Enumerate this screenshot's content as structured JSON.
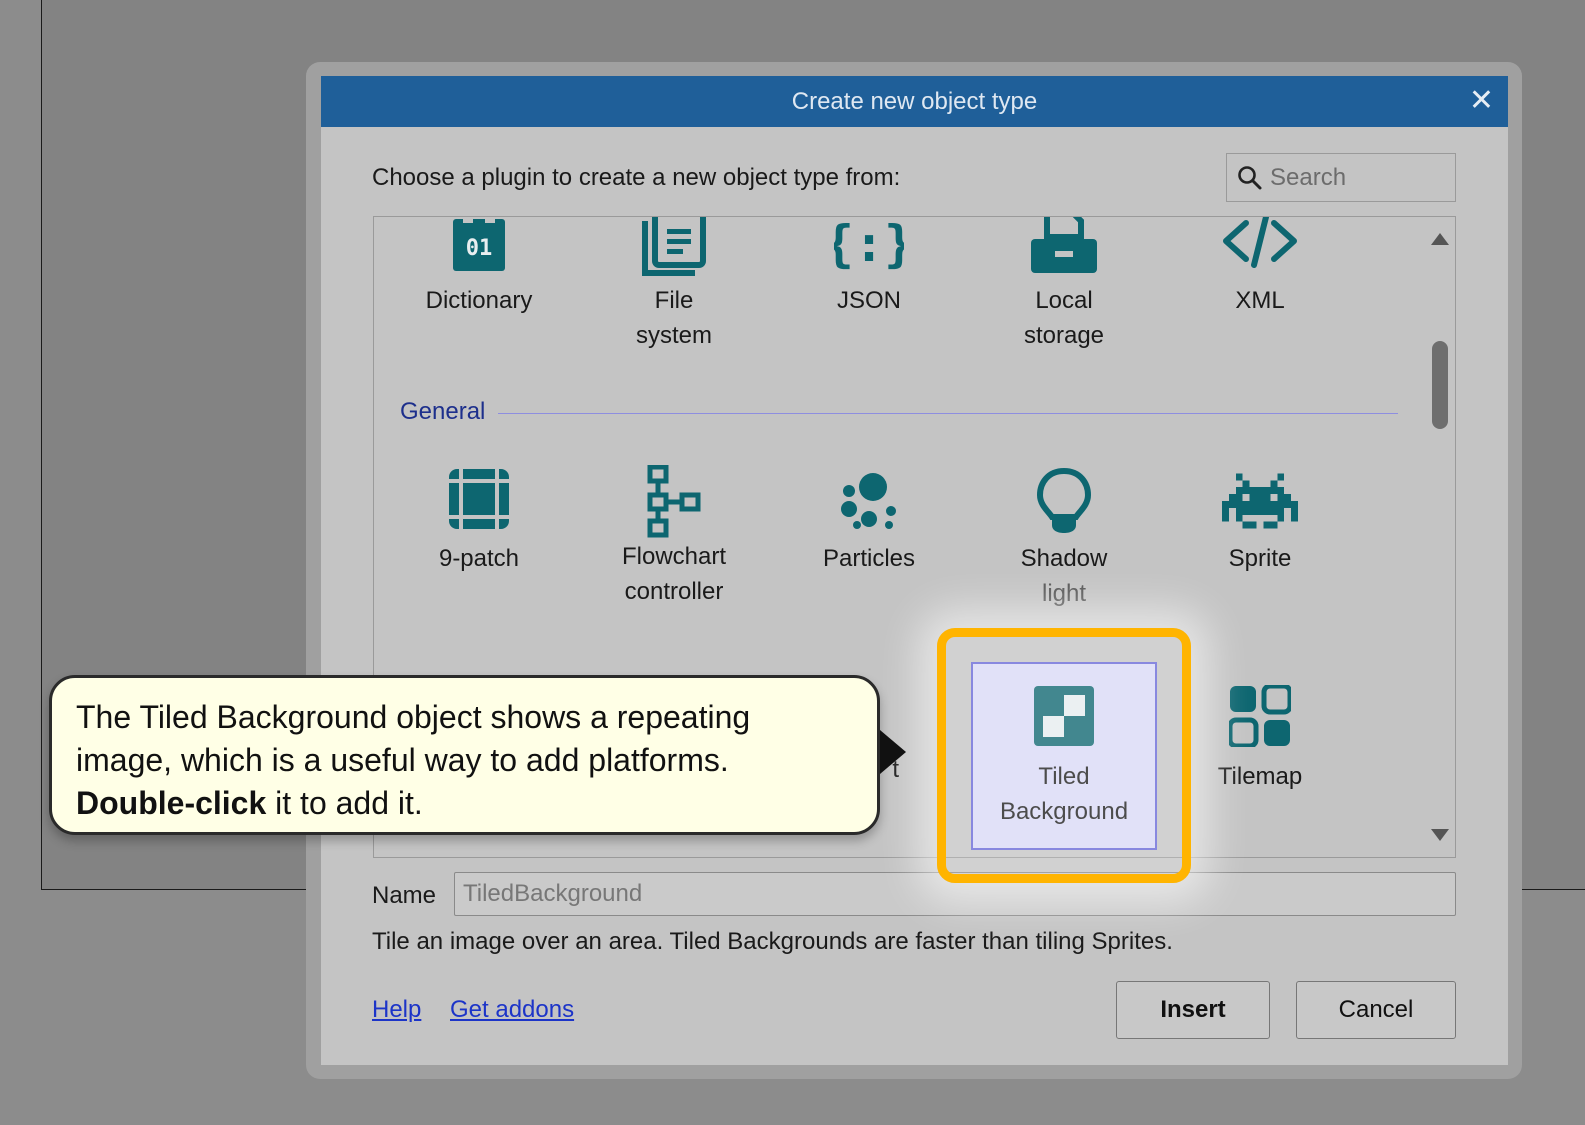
{
  "dialog": {
    "title": "Create new object type",
    "prompt": "Choose a plugin to create a new object type from:",
    "search_placeholder": "Search",
    "close_glyph": "✕"
  },
  "plugins_top": [
    {
      "line1": "Dictionary",
      "line2": "",
      "icon": "dictionary-icon"
    },
    {
      "line1": "File",
      "line2": "system",
      "icon": "file-system-icon"
    },
    {
      "line1": "JSON",
      "line2": "",
      "icon": "json-icon"
    },
    {
      "line1": "Local",
      "line2": "storage",
      "icon": "local-storage-icon"
    },
    {
      "line1": "XML",
      "line2": "",
      "icon": "xml-icon"
    }
  ],
  "section_general": "General",
  "plugins_general": [
    {
      "line1": "9-patch",
      "line2": "",
      "icon": "nine-patch-icon"
    },
    {
      "line1": "Flowchart",
      "line2": "controller",
      "icon": "flowchart-icon"
    },
    {
      "line1": "Particles",
      "line2": "",
      "icon": "particles-icon"
    },
    {
      "line1": "Shadow",
      "line2": "light",
      "icon": "shadow-light-icon"
    },
    {
      "line1": "Sprite",
      "line2": "",
      "icon": "sprite-icon"
    }
  ],
  "plugins_row3": [
    {
      "line1": "t",
      "line2": "",
      "icon": "partial-icon"
    },
    {
      "line1": "Tiled",
      "line2": "Background",
      "icon": "tiled-background-icon",
      "selected": true
    },
    {
      "line1": "Tilemap",
      "line2": "",
      "icon": "tilemap-icon"
    }
  ],
  "name_field": {
    "label": "Name",
    "value": "TiledBackground"
  },
  "description": "Tile an image over an area. Tiled Backgrounds are faster than tiling Sprites.",
  "links": {
    "help": "Help",
    "addons": "Get addons"
  },
  "buttons": {
    "insert": "Insert",
    "cancel": "Cancel"
  },
  "tooltip": {
    "text": "The Tiled Background object shows a repeating image, which is a useful way to add platforms.",
    "bold": "Double-click",
    "rest": " it to add it."
  },
  "colors": {
    "icon_teal": "#0d6670",
    "title_blue": "#1f5f99",
    "highlight": "#ffb400"
  }
}
